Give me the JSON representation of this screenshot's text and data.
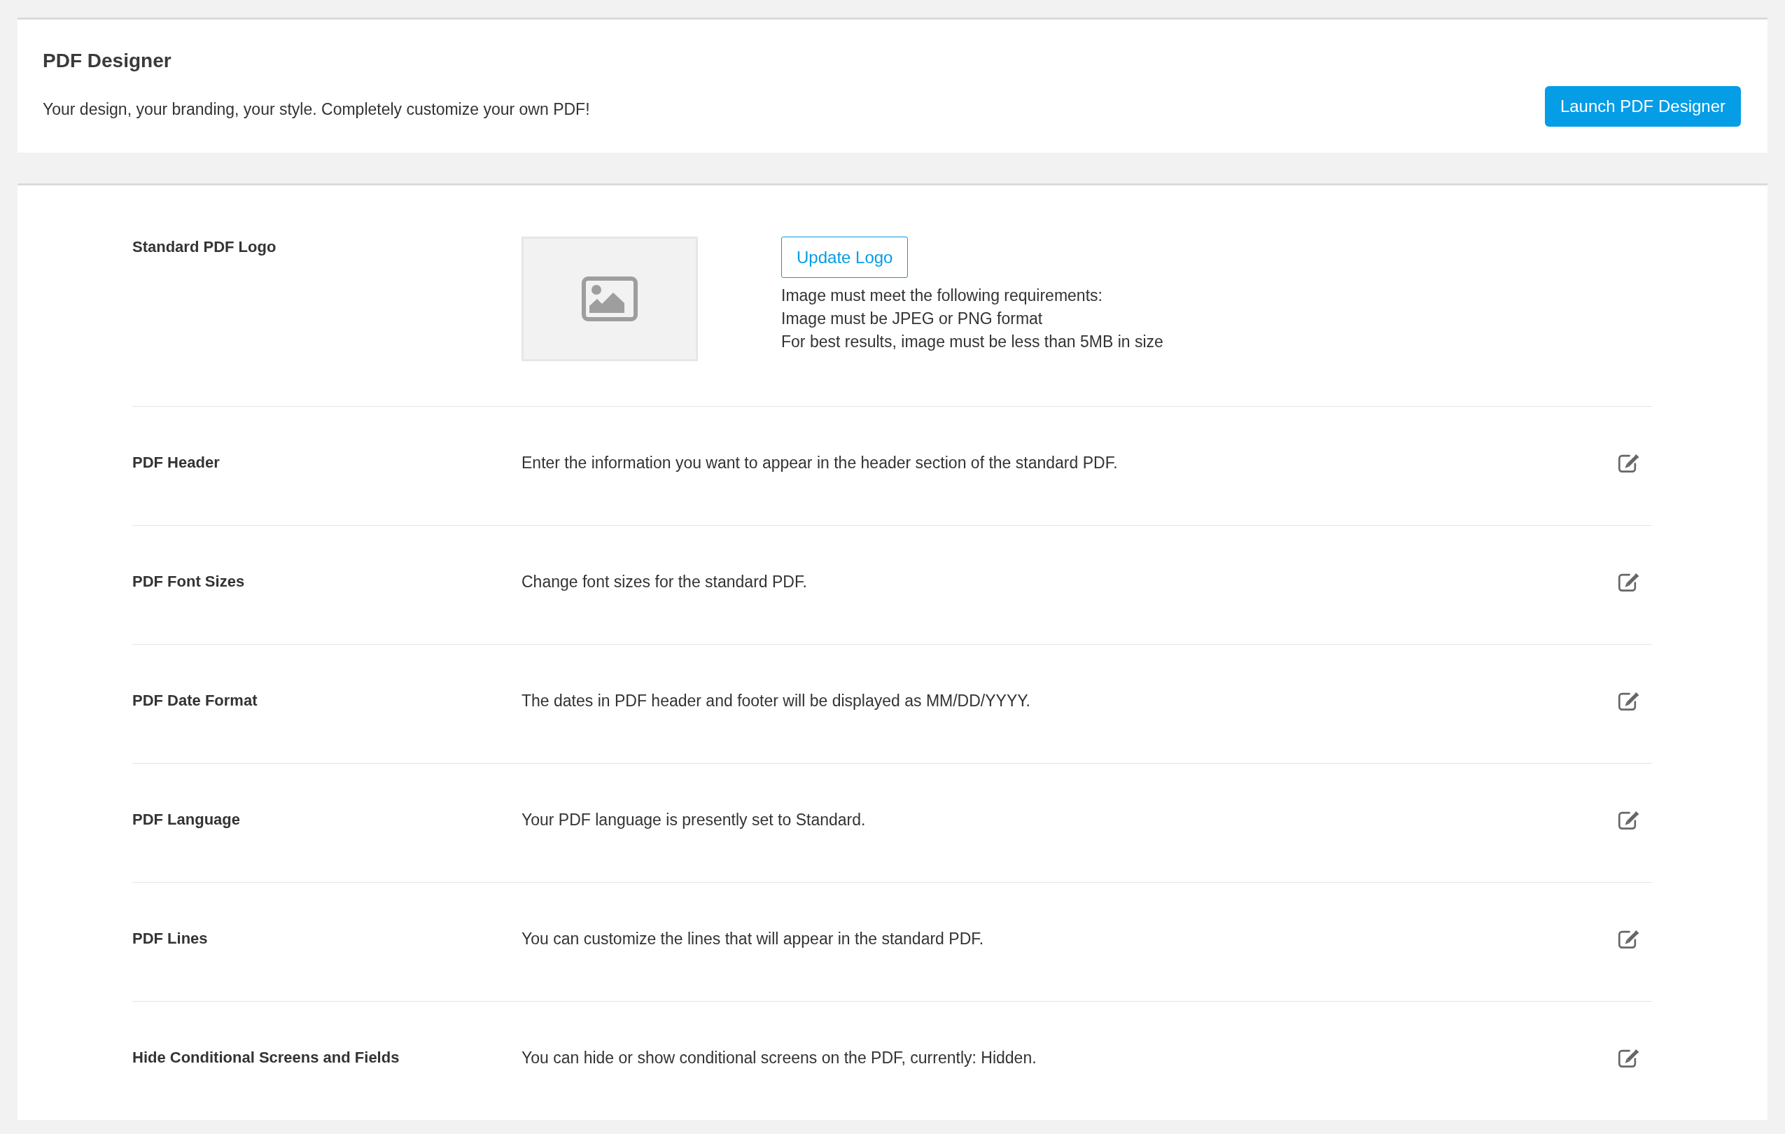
{
  "designer_card": {
    "title": "PDF Designer",
    "subtitle": "Your design, your branding, your style. Completely customize your own PDF!",
    "button": "Launch PDF Designer"
  },
  "settings": {
    "logo": {
      "label": "Standard PDF Logo",
      "button": "Update Logo",
      "requirements": [
        "Image must meet the following requirements:",
        "Image must be JPEG or PNG format",
        "For best results, image must be less than 5MB in size"
      ]
    },
    "rows": [
      {
        "label": "PDF Header",
        "description": "Enter the information you want to appear in the header section of the standard PDF."
      },
      {
        "label": "PDF Font Sizes",
        "description": "Change font sizes for the standard PDF."
      },
      {
        "label": "PDF Date Format",
        "description": "The dates in PDF header and footer will be displayed as MM/DD/YYYY."
      },
      {
        "label": "PDF Language",
        "description": "Your PDF language is presently set to Standard."
      },
      {
        "label": "PDF Lines",
        "description": "You can customize the lines that will appear in the standard PDF."
      },
      {
        "label": "Hide Conditional Screens and Fields",
        "description": "You can hide or show conditional screens on the PDF, currently: Hidden."
      }
    ]
  }
}
